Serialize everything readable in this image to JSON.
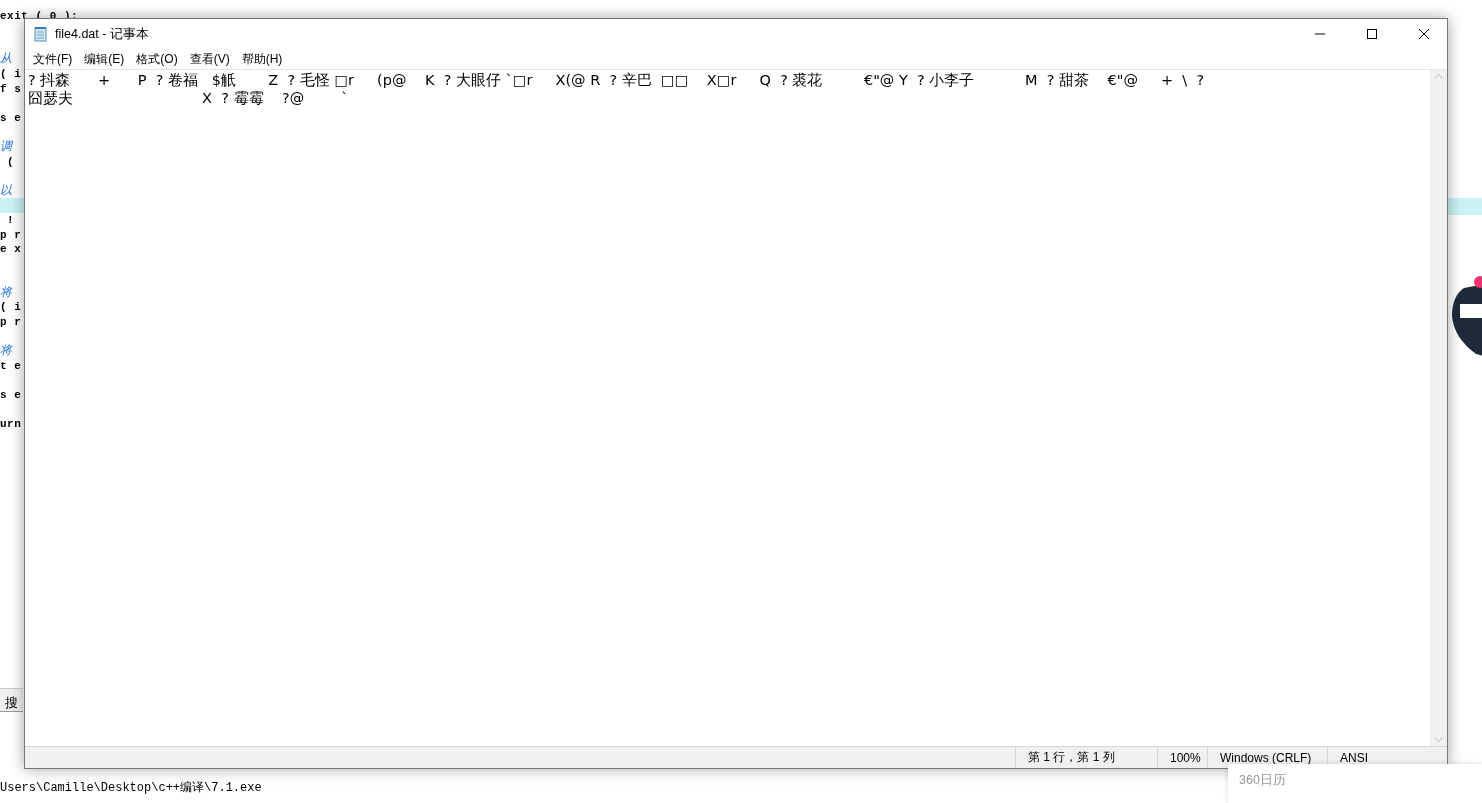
{
  "background_editor": {
    "lines": [
      {
        "kind": "blank"
      },
      {
        "text": "exit ( 0 );",
        "kind": "code"
      },
      {
        "kind": "blank"
      },
      {
        "kind": "blank"
      },
      {
        "text": "从",
        "kind": "comment"
      },
      {
        "text": "( i",
        "kind": "code"
      },
      {
        "text": "f s",
        "kind": "code"
      },
      {
        "kind": "blank"
      },
      {
        "text": "s e",
        "kind": "code"
      },
      {
        "kind": "blank"
      },
      {
        "text": "调",
        "kind": "comment"
      },
      {
        "text": " (",
        "kind": "code"
      },
      {
        "kind": "blank"
      },
      {
        "text": "以",
        "kind": "comment"
      },
      {
        "kind": "highlight"
      },
      {
        "text": " !",
        "kind": "code"
      },
      {
        "text": "p r",
        "kind": "code"
      },
      {
        "text": "e x",
        "kind": "code"
      },
      {
        "kind": "blank"
      },
      {
        "kind": "blank"
      },
      {
        "text": "将",
        "kind": "comment"
      },
      {
        "text": "( i",
        "kind": "code"
      },
      {
        "text": "p r",
        "kind": "code"
      },
      {
        "kind": "blank"
      },
      {
        "text": "将",
        "kind": "comment"
      },
      {
        "text": "t e",
        "kind": "code"
      },
      {
        "kind": "blank"
      },
      {
        "text": "s e",
        "kind": "code"
      },
      {
        "kind": "blank"
      },
      {
        "text": "urn",
        "kind": "code"
      }
    ],
    "search_tab": "搜",
    "console_lines": [
      "Users\\Camille\\Desktop\\c++编译\\7.1.exe"
    ]
  },
  "window": {
    "title": "file4.dat - 记事本"
  },
  "menu": [
    "文件(F)",
    "编辑(E)",
    "格式(O)",
    "查看(V)",
    "帮助(H)"
  ],
  "editor": {
    "lines": [
      "? 抖森      +      P  ? 卷福   $觗       Z  ? 毛怪 □r     (p@    K  ? 大眼仔 `□r     X(@ R  ? 辛巴  □□    X□r     Q  ? 裘花         €\"@ Y  ? 小李子           M  ? 甜茶    €\"@     +  \\  ?",
      "囧瑟夫                            X  ? 霉霉    ?@        `"
    ]
  },
  "status_bar": {
    "position": "第 1 行，第 1 列",
    "zoom": "100%",
    "line_ending": "Windows (CRLF)",
    "encoding": "ANSI"
  },
  "popup": {
    "title": "360日历"
  }
}
